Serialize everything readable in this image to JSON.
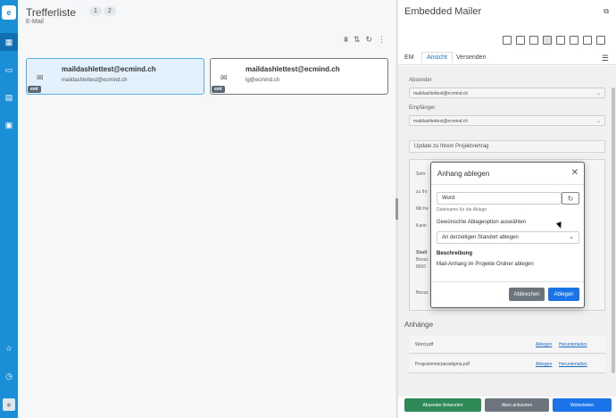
{
  "rail": {
    "logo": "e",
    "nav": [
      {
        "icon": "grid-icon",
        "glyph": "▦",
        "active": true
      },
      {
        "icon": "monitor-icon",
        "glyph": "▭"
      },
      {
        "icon": "inbox-icon",
        "glyph": "▤"
      },
      {
        "icon": "card-icon",
        "glyph": "▣"
      }
    ],
    "bottom": [
      {
        "icon": "star-icon",
        "glyph": "☆"
      },
      {
        "icon": "history-icon",
        "glyph": "◷"
      }
    ],
    "avatar_glyph": "●"
  },
  "trefferliste": {
    "title": "Trefferliste",
    "pages": [
      "1",
      "2"
    ],
    "subtitle": "E-Mail",
    "tools": {
      "filter": "⩩",
      "sort": "⇅",
      "refresh": "↻",
      "more": "⋮"
    },
    "cards": [
      {
        "title": "maildashlettest@ecmind.ch",
        "line2": "maildashlettest@ecmind.ch",
        "tag": "eml",
        "selected": true
      },
      {
        "title": "maildashlettest@ecmind.ch",
        "line2": "lg@ecmind.ch",
        "tag": "eml",
        "selected": false
      }
    ],
    "envelope_glyph": "✉"
  },
  "mailer": {
    "title": "Embedded Mailer",
    "expand_glyph": "⧉",
    "toolbar_icons": [
      "file-icon",
      "doc-icon",
      "pdf-icon",
      "database-icon",
      "save-icon",
      "tray-icon",
      "car-icon",
      "archive-icon"
    ],
    "tabs": [
      "EM",
      "Ansicht",
      "Versenden"
    ],
    "active_tab": "Ansicht",
    "menu_glyph": "☰",
    "absender_label": "Absender",
    "absender_value": "maildashlettest@ecmind.ch",
    "empfaenger_label": "Empfänger",
    "empfaenger_value": "maildashlettest@ecmind.ch",
    "subject": "Update zu Ihrem Projektvertrag",
    "body_lines": [
      "Sehr",
      "zu Ihr",
      "Mit fre",
      "Karin",
      "Stadt",
      "Besuc",
      "8500",
      "Besuc"
    ],
    "attachments_heading": "Anhänge",
    "attachments": [
      {
        "name": "Word.pdf",
        "action1": "Ablegen",
        "action2": "Herunterladen"
      },
      {
        "name": "Programmierparadigma.pdf",
        "action1": "Ablegen",
        "action2": "Herunterladen"
      }
    ],
    "footer_buttons": [
      {
        "label": "Absender Antworten",
        "color": "#2e8b57"
      },
      {
        "label": "Allen antworten",
        "color": "#6c757d"
      },
      {
        "label": "Weiterleiten",
        "color": "#1a73e8"
      }
    ]
  },
  "dialog": {
    "title": "Anhang ablegen",
    "close_glyph": "✕",
    "filename_value": "Word",
    "refresh_glyph": "↻",
    "filename_hint": "Dateiname für die Ablage",
    "option_label": "Gewünschte Ablageoption auswählen",
    "option_selected": "An derzeitigen Standort ablegen",
    "chevron_glyph": "⌄",
    "description_heading": "Beschreibung",
    "description_text": "Mail-Anhang im Projekte Ordner ablegen",
    "cancel_label": "Abbrechen",
    "confirm_label": "Ablegen"
  }
}
